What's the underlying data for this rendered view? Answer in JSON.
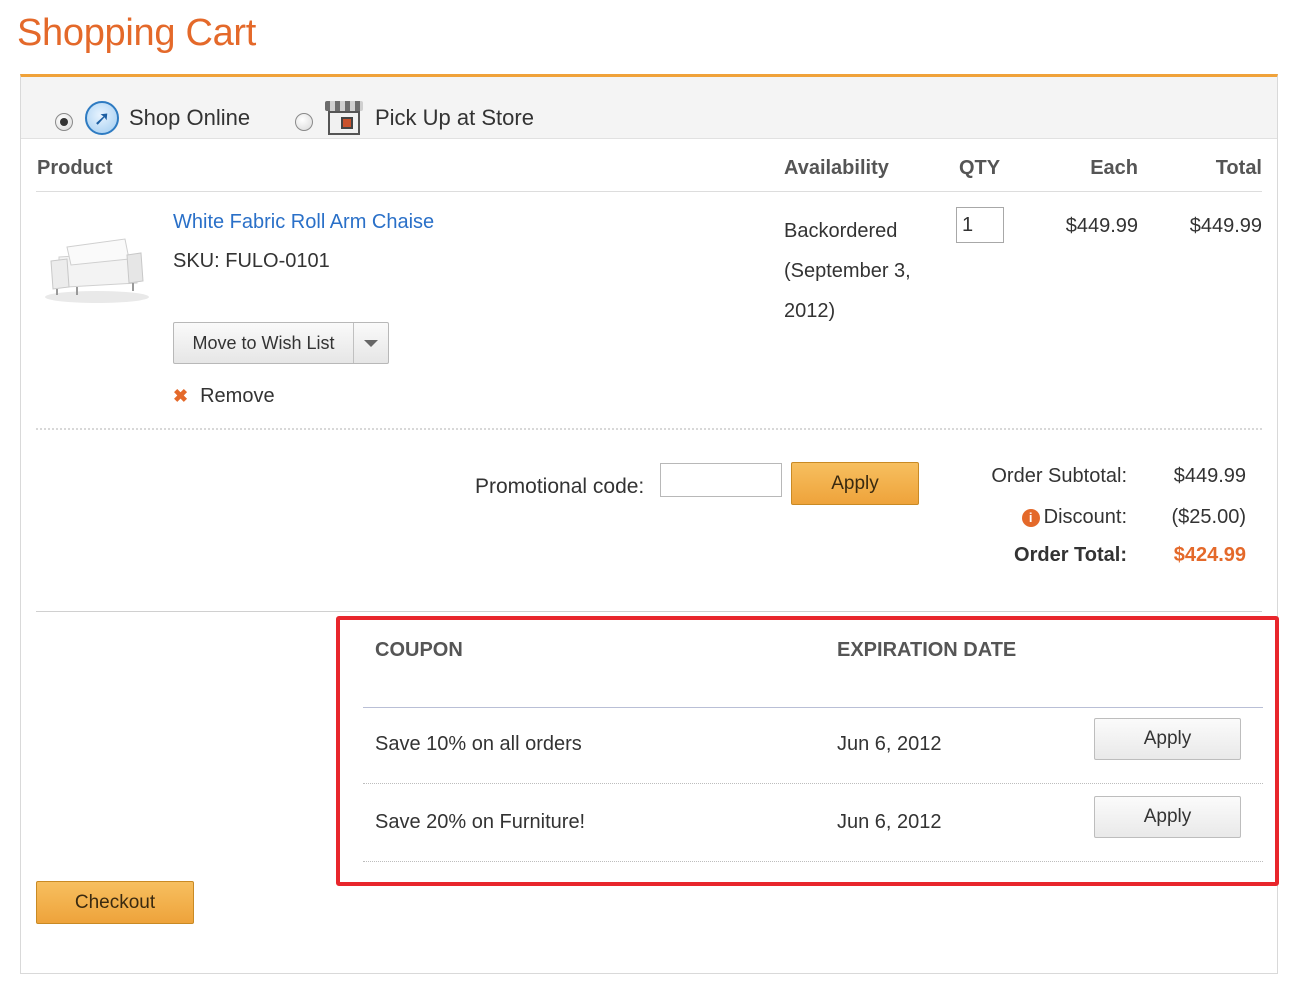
{
  "page": {
    "title": "Shopping Cart"
  },
  "shipping": {
    "options": [
      {
        "label": "Shop Online",
        "selected": true,
        "icon": "globe-icon"
      },
      {
        "label": "Pick Up at Store",
        "selected": false,
        "icon": "store-icon"
      }
    ]
  },
  "table": {
    "headers": {
      "product": "Product",
      "availability": "Availability",
      "qty": "QTY",
      "each": "Each",
      "total": "Total"
    }
  },
  "item": {
    "name": "White Fabric Roll Arm Chaise",
    "sku": "SKU: FULO-0101",
    "availability_line1": "Backordered",
    "availability_line2": "(September 3,",
    "availability_line3": "2012)",
    "qty": "1",
    "each": "$449.99",
    "total": "$449.99",
    "wish_list_label": "Move to Wish List",
    "remove_label": "Remove"
  },
  "promo": {
    "label": "Promotional code:",
    "value": "",
    "apply_label": "Apply"
  },
  "summary": {
    "subtotal_label": "Order Subtotal:",
    "subtotal_value": "$449.99",
    "discount_label": "Discount:",
    "discount_value": "($25.00)",
    "total_label": "Order Total:",
    "total_value": "$424.99"
  },
  "coupons": {
    "header_coupon": "COUPON",
    "header_expiration": "EXPIRATION DATE",
    "rows": [
      {
        "name": "Save 10% on all orders",
        "expires": "Jun 6, 2012",
        "apply_label": "Apply"
      },
      {
        "name": "Save 20% on Furniture!",
        "expires": "Jun 6, 2012",
        "apply_label": "Apply"
      }
    ]
  },
  "checkout": {
    "label": "Checkout"
  },
  "colors": {
    "accent": "#e4692a",
    "link": "#2a70c8",
    "highlight": "#e8262c",
    "button_orange": "#eea33b"
  }
}
